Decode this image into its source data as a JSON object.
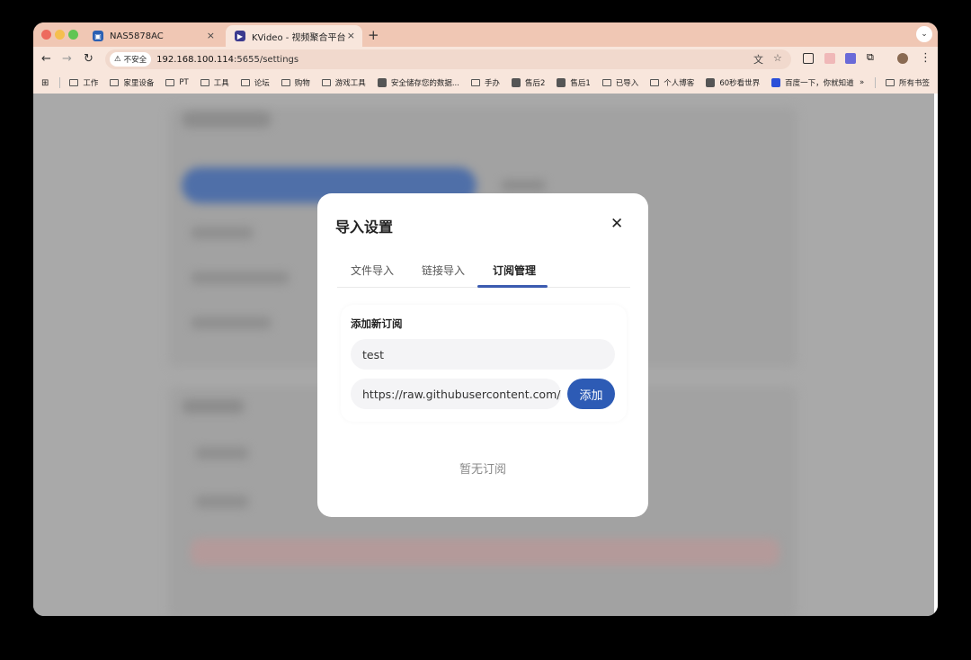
{
  "browser": {
    "tabs": [
      {
        "title": "NAS5878AC",
        "close": "×"
      },
      {
        "title": "KVideo - 视频聚合平台",
        "close": "×"
      }
    ],
    "new_tab": "+",
    "tab_menu": "⌄",
    "address": {
      "security_label": "不安全",
      "host": "192.168.100.114",
      "path": ":5655/settings"
    },
    "bookmarks": [
      {
        "label": "工作",
        "icon": "folder-icon"
      },
      {
        "label": "家里设备",
        "icon": "folder-icon"
      },
      {
        "label": "PT",
        "icon": "folder-icon"
      },
      {
        "label": "工具",
        "icon": "folder-icon"
      },
      {
        "label": "论坛",
        "icon": "folder-icon"
      },
      {
        "label": "购物",
        "icon": "folder-icon"
      },
      {
        "label": "游戏工具",
        "icon": "folder-icon"
      },
      {
        "label": "安全储存您的数据...",
        "icon": "site-icon"
      },
      {
        "label": "手办",
        "icon": "folder-icon"
      },
      {
        "label": "售后2",
        "icon": "site-icon"
      },
      {
        "label": "售后1",
        "icon": "site-icon"
      },
      {
        "label": "已导入",
        "icon": "folder-icon"
      },
      {
        "label": "个人博客",
        "icon": "folder-icon"
      },
      {
        "label": "60秒看世界",
        "icon": "site-icon"
      },
      {
        "label": "百度一下，你就知道",
        "icon": "baidu-icon"
      }
    ],
    "overflow": "»",
    "all_bookmarks": "所有书签"
  },
  "modal": {
    "title": "导入设置",
    "close": "✕",
    "tabs": [
      {
        "label": "文件导入",
        "active": false
      },
      {
        "label": "链接导入",
        "active": false
      },
      {
        "label": "订阅管理",
        "active": true
      }
    ],
    "add_section": {
      "heading": "添加新订阅",
      "name_value": "test",
      "url_value": "https://raw.githubusercontent.com/ra",
      "add_button": "添加"
    },
    "empty_text": "暂无订阅"
  },
  "colors": {
    "accent": "#2d5bb5",
    "tab_strip": "#f0c7b4",
    "toolbar": "#f8e6dc",
    "overlay": "#a9a9a9"
  }
}
